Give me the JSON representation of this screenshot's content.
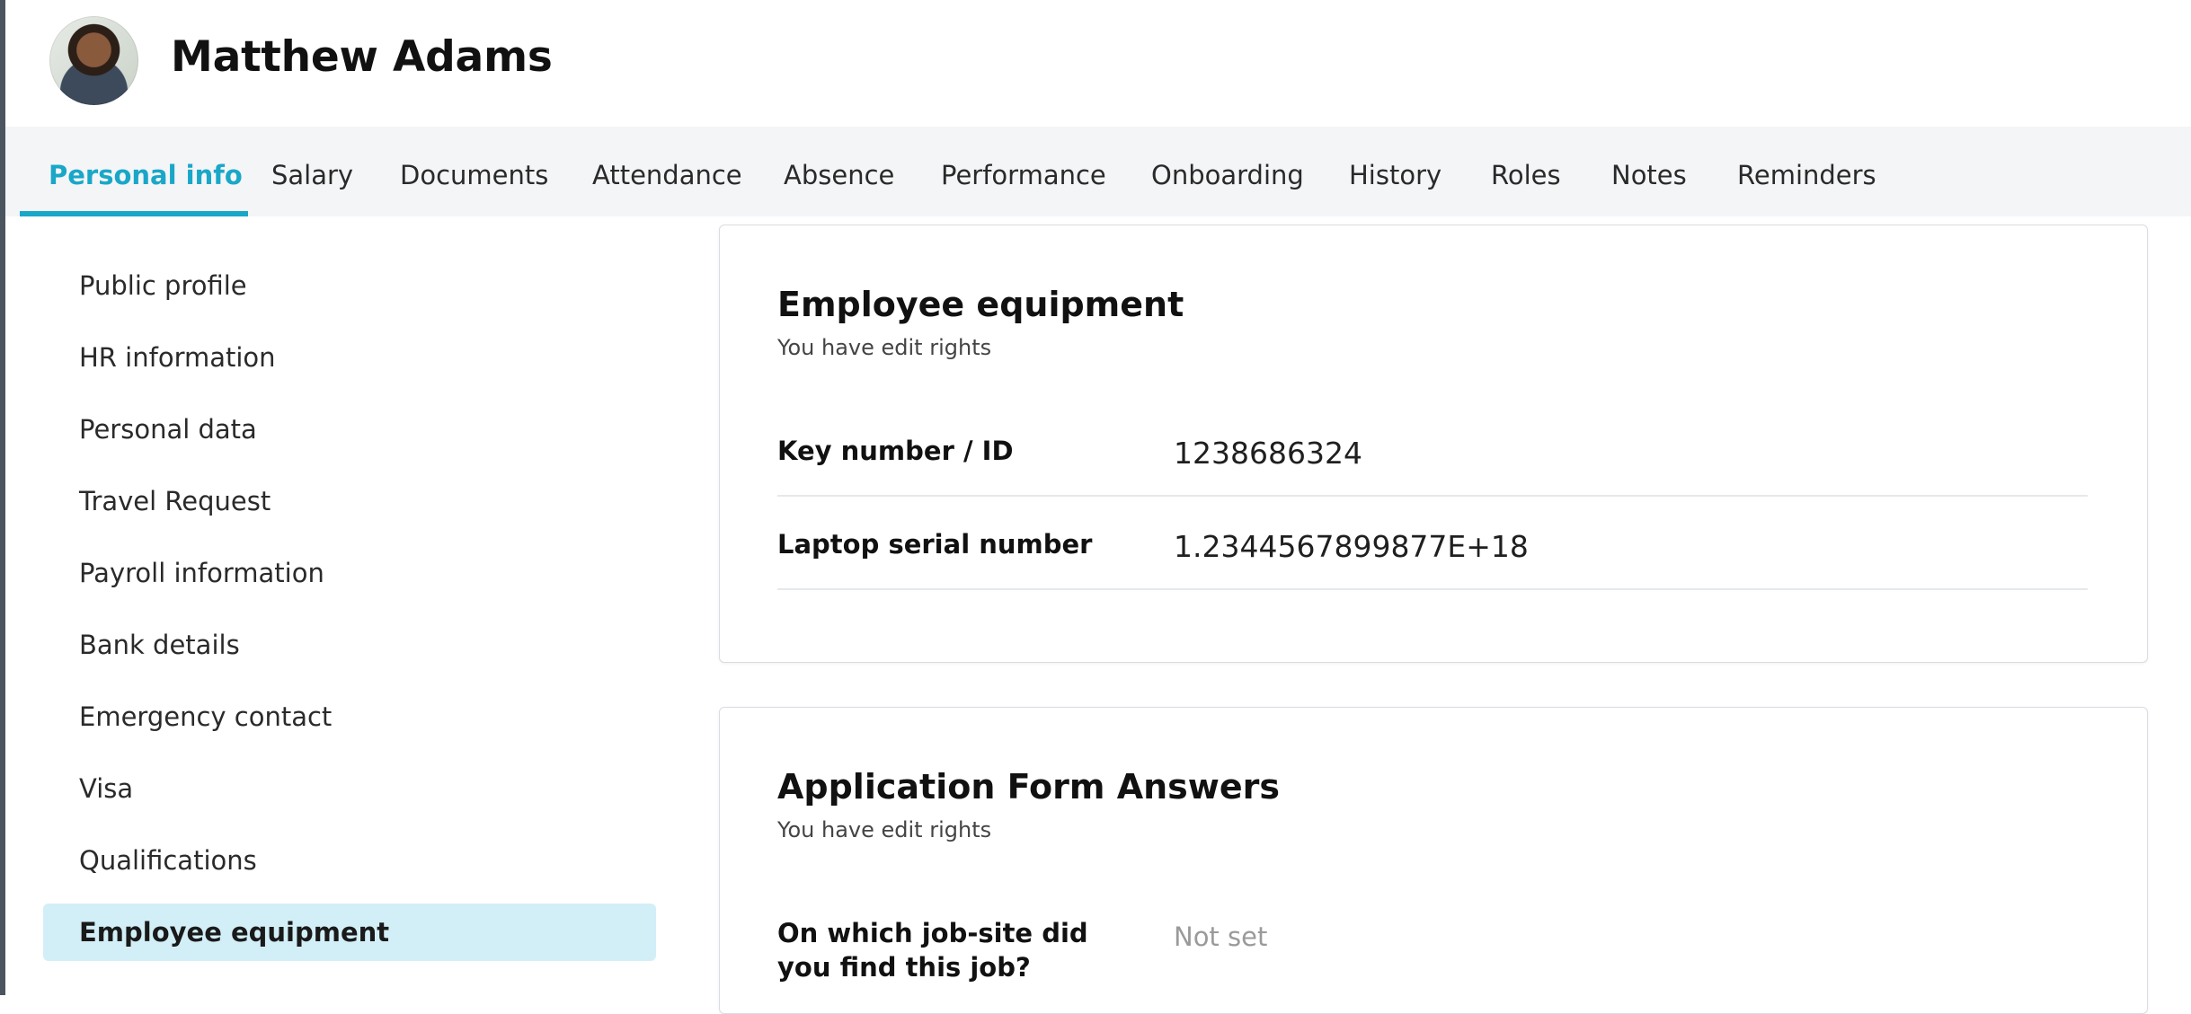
{
  "header": {
    "name": "Matthew Adams"
  },
  "tabs": [
    {
      "label": "Personal info",
      "active": true
    },
    {
      "label": "Salary"
    },
    {
      "label": "Documents"
    },
    {
      "label": "Attendance"
    },
    {
      "label": "Absence"
    },
    {
      "label": "Performance"
    },
    {
      "label": "Onboarding"
    },
    {
      "label": "History"
    },
    {
      "label": "Roles"
    },
    {
      "label": "Notes"
    },
    {
      "label": "Reminders"
    }
  ],
  "sidebar": {
    "items": [
      {
        "label": "Public profile"
      },
      {
        "label": "HR information"
      },
      {
        "label": "Personal data"
      },
      {
        "label": "Travel Request"
      },
      {
        "label": "Payroll information"
      },
      {
        "label": "Bank details"
      },
      {
        "label": "Emergency contact"
      },
      {
        "label": "Visa"
      },
      {
        "label": "Qualifications"
      },
      {
        "label": "Employee equipment",
        "active": true
      }
    ]
  },
  "equipment_card": {
    "title": "Employee equipment",
    "subtitle": "You have edit rights",
    "fields": [
      {
        "label": "Key number / ID",
        "value": "1238686324"
      },
      {
        "label": "Laptop serial number",
        "value": "1.2344567899877E+18"
      }
    ]
  },
  "application_card": {
    "title": "Application Form Answers",
    "subtitle": "You have edit rights",
    "fields": [
      {
        "label": "On which job-site did you find this job?",
        "value": "Not set"
      }
    ]
  },
  "colors": {
    "accent": "#19a7c8",
    "active_bg": "#d2eff7",
    "tabbar_bg": "#f4f5f7"
  }
}
